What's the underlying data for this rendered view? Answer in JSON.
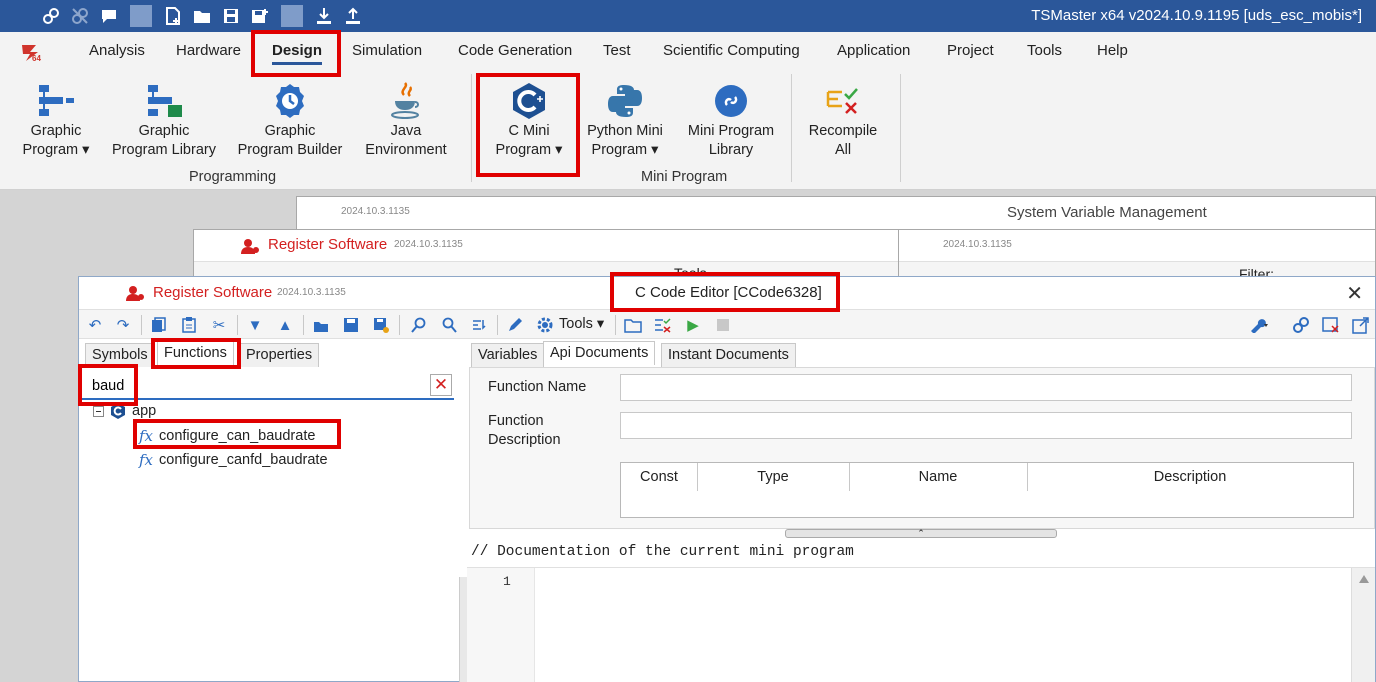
{
  "app": {
    "title": "TSMaster x64 v2024.10.9.1195 [uds_esc_mobis*]"
  },
  "menu": {
    "items": [
      "Analysis",
      "Hardware",
      "Design",
      "Simulation",
      "Code Generation",
      "Test",
      "Scientific Computing",
      "Application",
      "Project",
      "Tools",
      "Help"
    ],
    "active": "Design"
  },
  "ribbon": {
    "programming": {
      "label": "Programming",
      "buttons": [
        {
          "line1": "Graphic",
          "line2": "Program ▾",
          "icon": "graphic-program-icon"
        },
        {
          "line1": "Graphic",
          "line2": "Program Library",
          "icon": "graphic-program-library-icon"
        },
        {
          "line1": "Graphic",
          "line2": "Program Builder",
          "icon": "program-builder-icon"
        },
        {
          "line1": "Java",
          "line2": "Environment",
          "icon": "java-icon"
        }
      ]
    },
    "mini_program": {
      "label": "Mini Program",
      "buttons": [
        {
          "line1": "C Mini",
          "line2": "Program ▾",
          "icon": "c-mini-program-icon"
        },
        {
          "line1": "Python Mini",
          "line2": "Program ▾",
          "icon": "python-icon"
        },
        {
          "line1": "Mini Program",
          "line2": "Library",
          "icon": "mini-program-library-icon"
        },
        {
          "line1": "Recompile",
          "line2": "All",
          "icon": "recompile-icon"
        }
      ]
    }
  },
  "background_windows": {
    "sysvar": {
      "version": "2024.10.3.1135",
      "title": "System Variable Management"
    },
    "register1": {
      "title": "Register Software",
      "version": "2024.10.3.1135"
    },
    "right": {
      "version": "2024.10.3.1135",
      "filter_label": "Filter:"
    },
    "tools_label": "Tools"
  },
  "editor": {
    "register_title": "Register Software",
    "version": "2024.10.3.1135",
    "title": "C Code Editor [CCode6328]",
    "close": "✕",
    "tools_label": "Tools ▾",
    "left_tabs": [
      "Symbols",
      "Functions",
      "Properties"
    ],
    "search": {
      "value": "baud",
      "placeholder": ""
    },
    "tree": {
      "root": "app",
      "items": [
        "configure_can_baudrate",
        "configure_canfd_baudrate"
      ]
    },
    "right_tabs": [
      "Variables",
      "Api Documents",
      "Instant Documents"
    ],
    "api": {
      "function_name_label": "Function Name",
      "function_desc_label_1": "Function",
      "function_desc_label_2": "Description",
      "columns": [
        "Const",
        "Type",
        "Name",
        "Description"
      ]
    },
    "doc_comment": "// Documentation of the current mini program",
    "line_number": "1"
  },
  "colors": {
    "titlebar": "#2b579a",
    "highlight": "#e00000",
    "accent": "#2d6cc0"
  }
}
